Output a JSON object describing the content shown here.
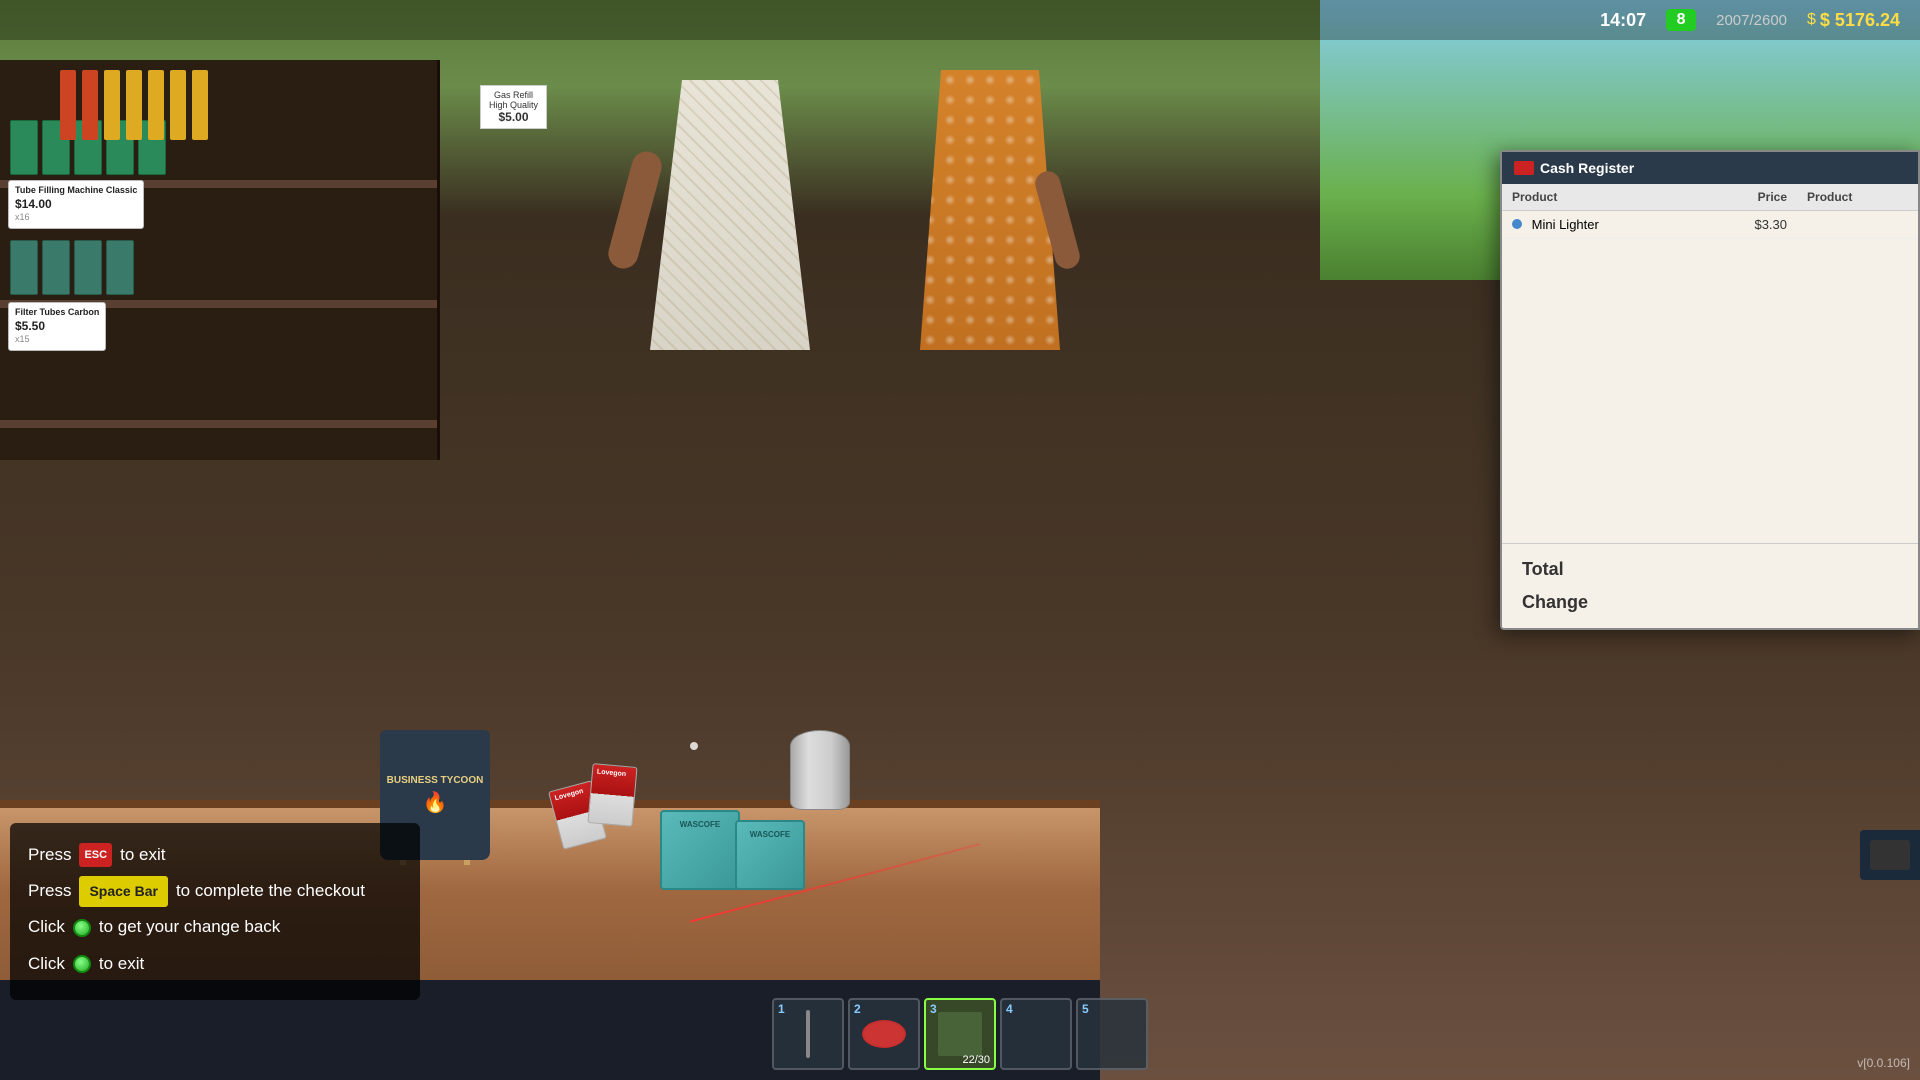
{
  "hud": {
    "time": "14:07",
    "customers": "8",
    "score": "2007/2600",
    "money": "$ 5176.24",
    "version": "v[0.0.106]"
  },
  "cash_register": {
    "title": "Cash Register",
    "columns": {
      "product": "Product",
      "price": "Price",
      "product2": "Product"
    },
    "items": [
      {
        "name": "Mini Lighter",
        "price": "$3.30"
      }
    ],
    "total_label": "Total",
    "change_label": "Change"
  },
  "shelf_items": [
    {
      "name": "Tube Filling Machine Classic",
      "price": "$14.00",
      "qty": "x16"
    },
    {
      "name": "Filter Tubes Carbon",
      "price": "$5.50",
      "qty": "x15"
    }
  ],
  "gas_refill": {
    "label": "Gas Refill\nHigh Quality",
    "price": "$5.00"
  },
  "bag": {
    "brand": "BUSINESS TYCOON"
  },
  "box_label": "WASCOFE",
  "instructions": {
    "exit_label": "to exit",
    "space_label": "Space Bar",
    "space_action": "to complete the checkout",
    "coin_change": "to get your change back",
    "coin_exit": "to exit"
  },
  "hotbar": {
    "slots": [
      {
        "number": "1",
        "icon": "stick",
        "count": ""
      },
      {
        "number": "2",
        "icon": "ashtray",
        "count": ""
      },
      {
        "number": "3",
        "icon": "box",
        "count": "22/30",
        "active": true
      },
      {
        "number": "4",
        "icon": "empty",
        "count": ""
      },
      {
        "number": "5",
        "icon": "empty",
        "count": ""
      }
    ]
  }
}
